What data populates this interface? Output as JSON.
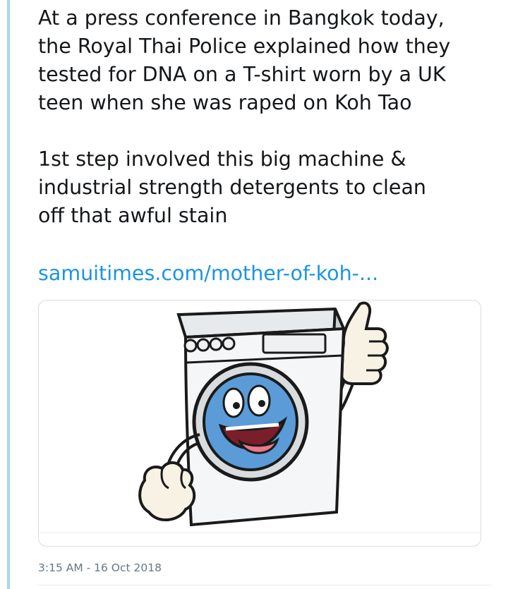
{
  "tweet": {
    "lines_p1": [
      "At a press conference in Bangkok today,",
      "the Royal Thai Police explained how they",
      "tested for DNA on a T-shirt worn by a UK",
      "teen when she was raped on Koh Tao"
    ],
    "lines_p2": [
      "1st step involved this big machine &",
      "industrial strength detergents to clean",
      "off that awful stain"
    ],
    "link_text": "samuitimes.com/mother-of-koh-...",
    "timestamp": "3:15 AM - 16 Oct 2018"
  },
  "card": {
    "image_subject": "cartoon washing machine giving thumbs up",
    "icon": "washing-machine-illustration",
    "colors": {
      "machine_body": "#f4f6f7",
      "machine_shade": "#c9ced2",
      "face": "#5b9bd8",
      "tongue": "#e8788a",
      "outline": "#1a1a1a"
    }
  },
  "colors": {
    "text": "#14171a",
    "link": "#1b95e0",
    "muted": "#657786",
    "rule": "#a9d4ee"
  }
}
